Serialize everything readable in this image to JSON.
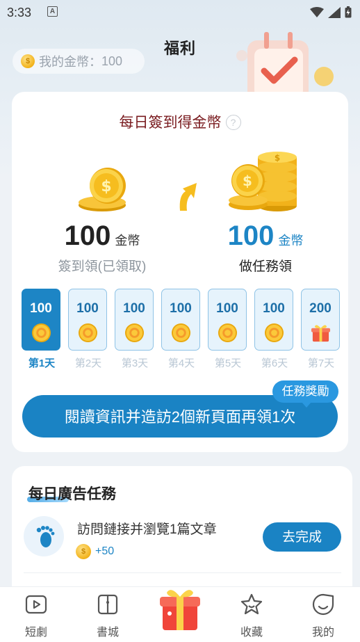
{
  "status_bar": {
    "time": "3:33",
    "notification_icon": "a-box-icon"
  },
  "header": {
    "title": "福利"
  },
  "coin_balance": {
    "label": "我的金幣：",
    "value": "100"
  },
  "sign_card": {
    "title": "每日簽到得金幣",
    "left": {
      "amount": "100",
      "unit": "金幣",
      "caption": "簽到領(已領取)"
    },
    "right": {
      "amount": "100",
      "unit": "金幣",
      "caption": "做任務領"
    },
    "days": [
      {
        "value": "100",
        "label": "第1天",
        "icon": "coin-icon",
        "active": true
      },
      {
        "value": "100",
        "label": "第2天",
        "icon": "coin-icon",
        "active": false
      },
      {
        "value": "100",
        "label": "第3天",
        "icon": "coin-icon",
        "active": false
      },
      {
        "value": "100",
        "label": "第4天",
        "icon": "coin-icon",
        "active": false
      },
      {
        "value": "100",
        "label": "第5天",
        "icon": "coin-icon",
        "active": false
      },
      {
        "value": "100",
        "label": "第6天",
        "icon": "coin-icon",
        "active": false
      },
      {
        "value": "200",
        "label": "第7天",
        "icon": "gift-box-icon",
        "active": false
      }
    ],
    "badge": "任務獎勵",
    "action_button": "閱讀資訊并造訪2個新頁面再領1次"
  },
  "ad_card": {
    "title": "每日廣告任務",
    "task": {
      "text": "訪問鏈接并瀏覽1篇文章",
      "reward": "+50",
      "button": "去完成",
      "icon": "footprint-icon"
    }
  },
  "bottom_nav": [
    {
      "label": "短劇",
      "icon": "play-icon"
    },
    {
      "label": "書城",
      "icon": "book-icon"
    },
    {
      "label": "",
      "icon": "gift-icon"
    },
    {
      "label": "收藏",
      "icon": "star-icon"
    },
    {
      "label": "我的",
      "icon": "smile-icon"
    }
  ],
  "colors": {
    "primary": "#1a83c4",
    "title_red": "#7a1c20",
    "coin_gold": "#f2b21a"
  }
}
